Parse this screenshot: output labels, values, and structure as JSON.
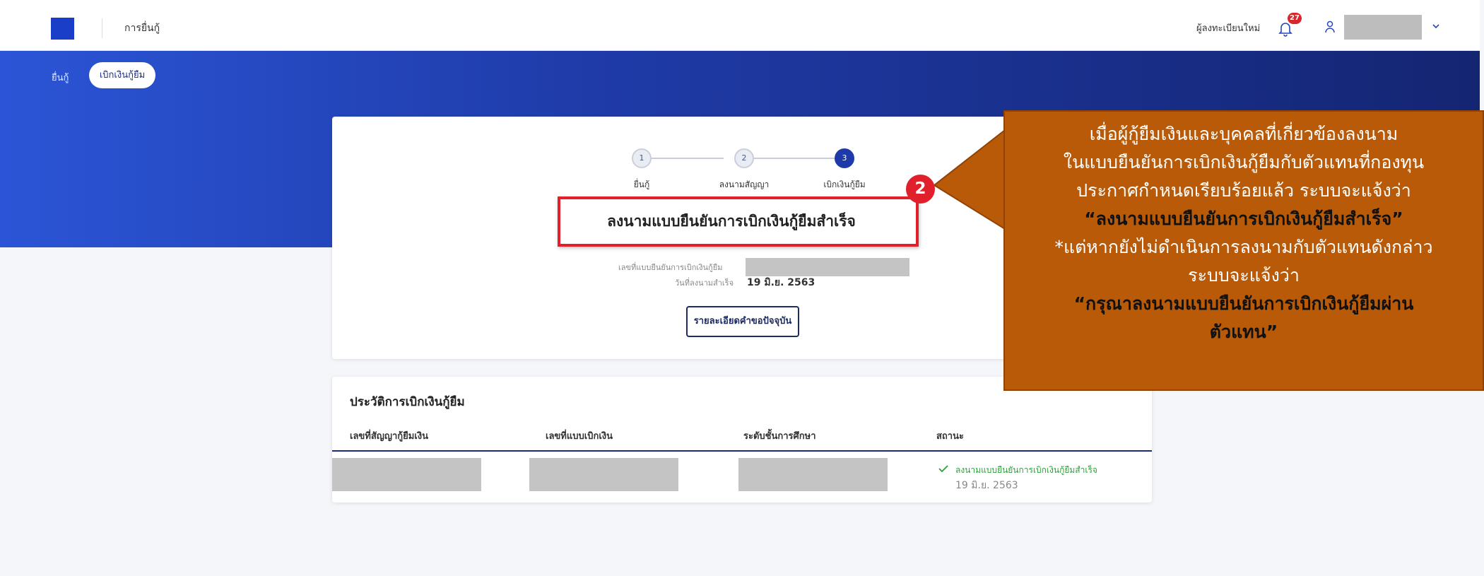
{
  "header": {
    "app_title": "การยื่นกู้",
    "register_link": "ผู้ลงทะเบียนใหม่",
    "notification_count": "27",
    "icons": [
      "logo",
      "bell-icon",
      "user-icon",
      "chevron-down-icon"
    ]
  },
  "tabs": {
    "loan": "ยื่นกู้",
    "withdraw": "เบิกเงินกู้ยืม"
  },
  "steps": [
    {
      "number": "1",
      "label": "ยื่นกู้"
    },
    {
      "number": "2",
      "label": "ลงนามสัญญา"
    },
    {
      "number": "3",
      "label": "เบิกเงินกู้ยืม"
    }
  ],
  "result": {
    "title": "ลงนามแบบยืนยันการเบิกเงินกู้ยืมสำเร็จ",
    "confirm_no_label": "เลขที่แบบยืนยันการเบิกเงินกู้ยืม",
    "signed_date_label": "วันที่ลงนามสำเร็จ",
    "signed_date": "19 มิ.ย. 2563",
    "detail_button": "รายละเอียดคำขอปัจจุบัน"
  },
  "history": {
    "title": "ประวัติการเบิกเงินกู้ยืม",
    "columns": [
      "เลขที่สัญญากู้ยืมเงิน",
      "เลขที่แบบเบิกเงิน",
      "ระดับชั้นการศึกษา",
      "สถานะ"
    ],
    "row": {
      "status": "ลงนามแบบยืนยันการเบิกเงินกู้ยืมสำเร็จ",
      "date": "19 มิ.ย. 2563"
    }
  },
  "annotation": {
    "number": "2",
    "lines": [
      "เมื่อผู้กู้ยืมเงินและบุคคลที่เกี่ยวข้องลงนาม",
      "ในแบบยืนยันการเบิกเงินกู้ยืมกับตัวแทนที่กองทุน",
      "ประกาศกำหนดเรียบร้อยแล้ว ระบบจะแจ้งว่า",
      "“ลงนามแบบยืนยันการเบิกเงินกู้ยืมสำเร็จ”",
      "*แต่หากยังไม่ดำเนินการลงนามกับตัวแทนดังกล่าว",
      "ระบบจะแจ้งว่า",
      "“กรุณาลงนามแบบยืนยันการเบิกเงินกู้ยืมผ่าน",
      "ตัวแทน”"
    ],
    "colors": {
      "box": "#b85a08",
      "marker": "#e0202a"
    }
  }
}
